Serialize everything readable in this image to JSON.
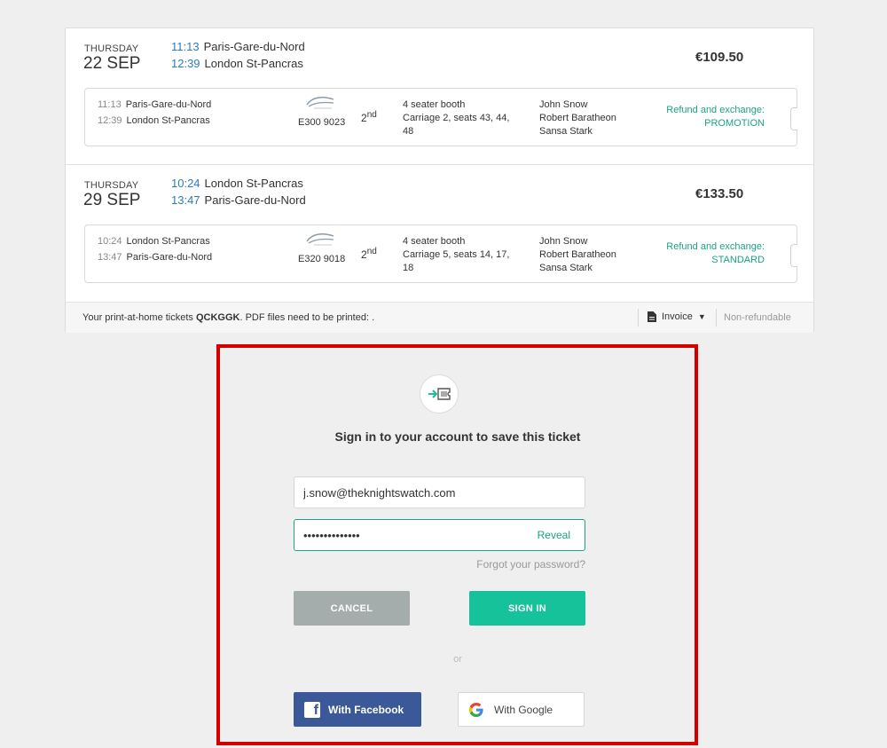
{
  "journeys": [
    {
      "day": "THURSDAY",
      "date": "22 SEP",
      "depart_time": "11:13",
      "depart_station": "Paris-Gare-du-Nord",
      "arrive_time": "12:39",
      "arrive_station": "London St-Pancras",
      "price": "€109.50",
      "segment": {
        "depart_time": "11:13",
        "depart_station": "Paris-Gare-du-Nord",
        "arrive_time": "12:39",
        "arrive_station": "London St-Pancras",
        "train_number": "E300 9023",
        "class_number": "2",
        "class_suffix": "nd",
        "seat_type": "4 seater booth",
        "seat_detail": "Carriage 2, seats 43, 44, 48",
        "passengers": [
          "John Snow",
          "Robert Baratheon",
          "Sansa Stark"
        ],
        "refund_label": "Refund and exchange:",
        "refund_type": "PROMOTION"
      }
    },
    {
      "day": "THURSDAY",
      "date": "29 SEP",
      "depart_time": "10:24",
      "depart_station": "London St-Pancras",
      "arrive_time": "13:47",
      "arrive_station": "Paris-Gare-du-Nord",
      "price": "€133.50",
      "segment": {
        "depart_time": "10:24",
        "depart_station": "London St-Pancras",
        "arrive_time": "13:47",
        "arrive_station": "Paris-Gare-du-Nord",
        "train_number": "E320 9018",
        "class_number": "2",
        "class_suffix": "nd",
        "seat_type": "4 seater booth",
        "seat_detail": "Carriage 5, seats 14, 17, 18",
        "passengers": [
          "John Snow",
          "Robert Baratheon",
          "Sansa Stark"
        ],
        "refund_label": "Refund and exchange:",
        "refund_type": "STANDARD"
      }
    }
  ],
  "footer": {
    "text_before": "Your print-at-home tickets ",
    "booking_ref": "QCKGGK",
    "text_after": ". PDF files need to be printed: .",
    "invoice_label": "Invoice",
    "invoice_caret": "▼",
    "refund_status": "Non-refundable"
  },
  "signin": {
    "icon": "ticket-arrow-icon",
    "title": "Sign in to your account to save this ticket",
    "email_value": "j.snow@theknightswatch.com",
    "password_value": "••••••••••••••",
    "reveal_label": "Reveal",
    "forgot_label": "Forgot your password?",
    "cancel_label": "CANCEL",
    "signin_label": "SIGN IN",
    "or_label": "or",
    "facebook_label": "With Facebook",
    "google_label": "With Google"
  },
  "colors": {
    "accent_green": "#16c29a",
    "link_blue": "#2b7bc3",
    "facebook_blue": "#3b5998",
    "cancel_gray": "#a4adab",
    "highlight_red": "#d40000"
  }
}
